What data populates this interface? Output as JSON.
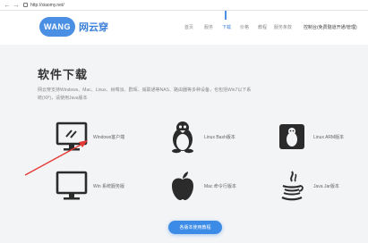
{
  "browser": {
    "back": "←",
    "forward": "→",
    "url": "http://xiaomy.net/"
  },
  "header": {
    "logo_badge": "WANG",
    "logo_name": "网云穿",
    "nav": [
      {
        "label": "首页"
      },
      {
        "label": "服务"
      },
      {
        "label": "下载",
        "active": true
      },
      {
        "label": "价格"
      },
      {
        "label": "教程"
      },
      {
        "label": "服务条款"
      }
    ],
    "login": "控制台(免费隧道开通/管理)"
  },
  "main": {
    "title": "软件下载",
    "desc": "网云穿支持Windows、Mac、Linux、树莓派、群晖、威联通等NAS、路由器等多种设备，也包括Win7以下系统(XP)，请使用Java版本"
  },
  "downloads": [
    {
      "label": "Windows客户端",
      "icon": "monitor-active-icon"
    },
    {
      "label": "Linux Bash版本",
      "icon": "linux-penguin-icon"
    },
    {
      "label": "Linux ARM版本",
      "icon": "arm-linux-icon"
    },
    {
      "label": "Win 系统服务版",
      "icon": "monitor-icon"
    },
    {
      "label": "Mac 命令行版本",
      "icon": "apple-icon"
    },
    {
      "label": "Java Jar版本",
      "icon": "java-icon"
    }
  ],
  "cta": {
    "label": "各版本使用教程"
  },
  "colors": {
    "accent": "#3c8be6",
    "brand": "#4a8fe3",
    "arrow": "#e53935"
  }
}
